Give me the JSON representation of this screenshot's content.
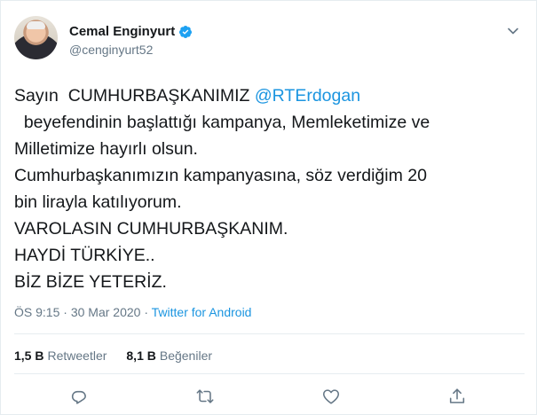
{
  "user": {
    "display_name": "Cemal Enginyurt",
    "handle": "@cenginyurt52"
  },
  "tweet": {
    "lines": [
      {
        "before": "Sayın  CUMHURBAŞKANIMIZ ",
        "mention": "@RTErdogan",
        "after": ""
      },
      {
        "text": "  beyefendinin başlattığı kampanya, Memleketimize ve"
      },
      {
        "text": "Milletimize hayırlı olsun."
      },
      {
        "text": "Cumhurbaşkanımızın kampanyasına, söz verdiğim 20"
      },
      {
        "text": "bin lirayla katılıyorum."
      },
      {
        "text": "VAROLASIN CUMHURBAŞKANIM."
      },
      {
        "text": "HAYDİ TÜRKİYE.."
      },
      {
        "text": "BİZ BİZE YETERİZ."
      }
    ]
  },
  "meta": {
    "time": "ÖS 9:15",
    "separator1": " · ",
    "date": "30 Mar 2020",
    "separator2": " · ",
    "source": "Twitter for Android"
  },
  "stats": {
    "retweets_count": "1,5 B",
    "retweets_label": "Retweetler",
    "likes_count": "8,1 B",
    "likes_label": "Beğeniler"
  },
  "colors": {
    "link": "#1b95e0",
    "text": "#14171a",
    "muted": "#657786",
    "verified": "#1da1f2"
  },
  "icons": [
    "verified-badge-icon",
    "chevron-down-icon",
    "reply-icon",
    "retweet-icon",
    "like-icon",
    "share-icon"
  ]
}
